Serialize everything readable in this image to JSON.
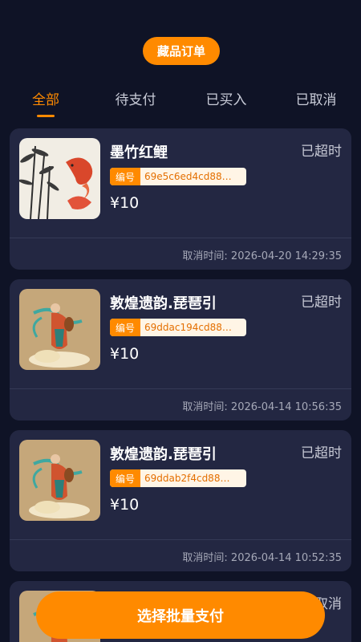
{
  "header": {
    "title": "藏品订单"
  },
  "tabs": [
    {
      "label": "全部",
      "active": true
    },
    {
      "label": "待支付",
      "active": false
    },
    {
      "label": "已买入",
      "active": false
    },
    {
      "label": "已取消",
      "active": false
    }
  ],
  "orders": [
    {
      "title": "墨竹红鲤",
      "status": "已超时",
      "code_label": "编号",
      "code": "69e5c6ed4cd88…",
      "price": "¥10",
      "cancel_time": "取消时间: 2026-04-20 14:29:35",
      "thumb_icon": "koi-bamboo-painting"
    },
    {
      "title": "敦煌遗韵.琵琶引",
      "status": "已超时",
      "code_label": "编号",
      "code": "69ddac194cd88…",
      "price": "¥10",
      "cancel_time": "取消时间: 2026-04-14 10:56:35",
      "thumb_icon": "dunhuang-flying-apsara"
    },
    {
      "title": "敦煌遗韵.琵琶引",
      "status": "已超时",
      "code_label": "编号",
      "code": "69ddab2f4cd88…",
      "price": "¥10",
      "cancel_time": "取消时间: 2026-04-14 10:52:35",
      "thumb_icon": "dunhuang-flying-apsara"
    },
    {
      "title": "",
      "status": "已取消",
      "thumb_icon": "dunhuang-flying-apsara"
    }
  ],
  "footer": {
    "button_label": "选择批量支付"
  },
  "colors": {
    "accent": "#ff8a00",
    "background": "#0f1326",
    "card": "#232742"
  }
}
